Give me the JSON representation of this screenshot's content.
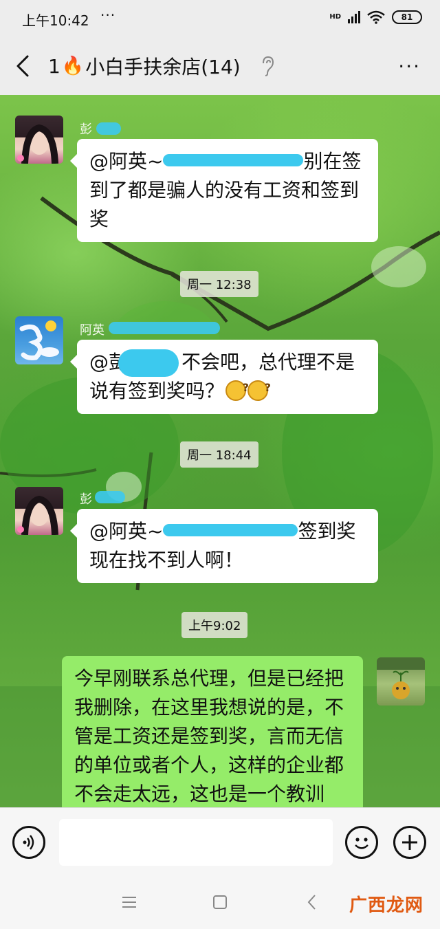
{
  "status_bar": {
    "time": "上午10:42",
    "more": "···",
    "network": "HD",
    "battery": "81"
  },
  "header": {
    "title_prefix": "1",
    "fire_emoji": "🔥",
    "title": "小白手扶余店(14)",
    "more": "···"
  },
  "messages": [
    {
      "type": "in",
      "sender": "彭",
      "sender_extra": "",
      "text": "@阿英~",
      "text_rest": "别在签到了都是骗人的没有工资和签到奖"
    },
    {
      "type": "time",
      "text": "周一 12:38"
    },
    {
      "type": "in",
      "sender": "阿英",
      "text": "@彭",
      "text_rest": "不会吧，总代理不是说有签到奖吗？"
    },
    {
      "type": "time",
      "text": "周一 18:44"
    },
    {
      "type": "in",
      "sender": "彭",
      "text": "@阿英~",
      "text_rest": "签到奖现在找不到人啊！"
    },
    {
      "type": "time",
      "text": "上午9:02"
    },
    {
      "type": "out",
      "text": "今早刚联系总代理，但是已经把我删除，在这里我想说的是，不管是工资还是签到奖，言而无信的单位或者个人，这样的企业都不会走太远，这也是一个教训"
    }
  ],
  "input": {
    "placeholder": ""
  },
  "watermark": "广西龙网"
}
